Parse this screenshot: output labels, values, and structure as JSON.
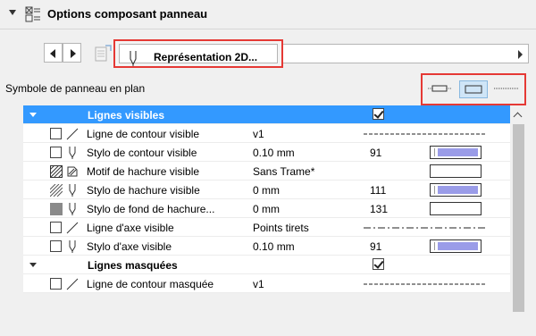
{
  "header": {
    "title": "Options composant panneau"
  },
  "toolbar": {
    "representation_label": "Représentation 2D..."
  },
  "symbol": {
    "label": "Symbole de panneau en plan"
  },
  "sections": [
    {
      "title": "Lignes visibles",
      "checked": true,
      "selected": true,
      "rows": [
        {
          "name": "Ligne de contour visible",
          "value": "v1",
          "number": "",
          "display": "dashed-line",
          "checked": false,
          "icon1": "checkbox",
          "icon2": "line-icon"
        },
        {
          "name": "Stylo de contour visible",
          "value": "0.10 mm",
          "number": "91",
          "display": "pen-swatch",
          "checked": false,
          "icon1": "checkbox",
          "icon2": "pen-icon"
        },
        {
          "name": "Motif de hachure visible",
          "value": "Sans Trame*",
          "number": "",
          "display": "empty-box",
          "checked": false,
          "icon1": "hatch-pattern-icon",
          "icon2": "hatch-tool-icon"
        },
        {
          "name": "Stylo de hachure visible",
          "value": "0 mm",
          "number": "111",
          "display": "pen-swatch",
          "checked": false,
          "icon1": "hatch-lines-icon",
          "icon2": "pen-icon"
        },
        {
          "name": "Stylo de fond de hachure...",
          "value": "0 mm",
          "number": "131",
          "display": "empty-box",
          "checked": false,
          "icon1": "filled-square-icon",
          "icon2": "pen-icon"
        },
        {
          "name": "Ligne d'axe visible",
          "value": "Points tirets",
          "number": "",
          "display": "dash-dot-line",
          "checked": false,
          "icon1": "checkbox",
          "icon2": "line-icon"
        },
        {
          "name": "Stylo d'axe visible",
          "value": "0.10 mm",
          "number": "91",
          "display": "pen-swatch",
          "checked": false,
          "icon1": "checkbox",
          "icon2": "pen-icon"
        }
      ]
    },
    {
      "title": "Lignes masquées",
      "checked": true,
      "selected": false,
      "rows": [
        {
          "name": "Ligne de contour masquée",
          "value": "v1",
          "number": "",
          "display": "dashed-line",
          "checked": false,
          "icon1": "checkbox",
          "icon2": "line-icon"
        }
      ]
    }
  ],
  "colors": {
    "selection": "#3399ff",
    "highlight_border": "#e53935",
    "pen_fill": "#9a9ce8"
  }
}
